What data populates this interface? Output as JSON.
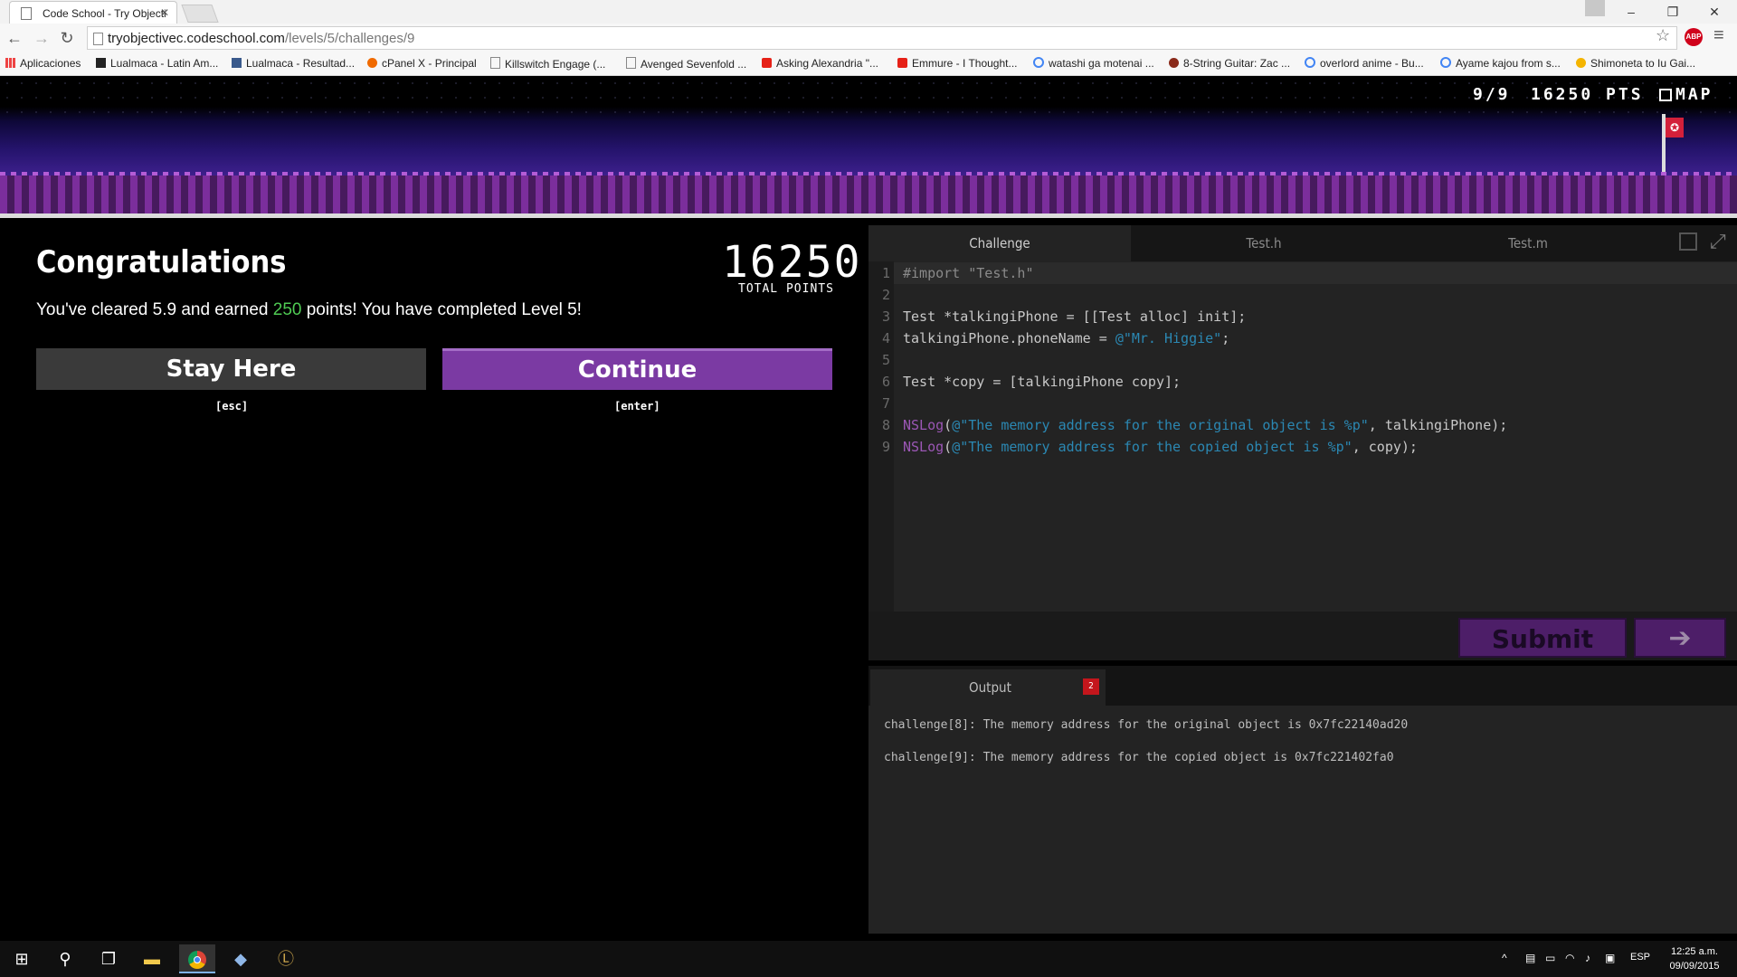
{
  "browser": {
    "tab_title": "Code School - Try Objecti",
    "url_domain": "tryobjectivec.codeschool.com",
    "url_path": "/levels/5/challenges/9",
    "bookmarks": [
      "Aplicaciones",
      "Lualmaca - Latin Am...",
      "Lualmaca - Resultad...",
      "cPanel X - Principal",
      "Killswitch Engage (...",
      "Avenged Sevenfold ...",
      "Asking Alexandria \"...",
      "Emmure - I Thought...",
      "watashi ga motenai ...",
      "8-String Guitar: Zac ...",
      "overlord anime - Bu...",
      "Ayame kajou from s...",
      "Shimoneta to Iu Gai..."
    ]
  },
  "hud": {
    "progress": "9/9",
    "points": "16250 PTS",
    "map": "MAP"
  },
  "result": {
    "title": "Congratulations",
    "total_points": "16250",
    "total_points_label": "TOTAL POINTS",
    "message_prefix": "You've cleared 5.9 and earned ",
    "earned_points": "250",
    "message_suffix": " points! You have completed Level 5!",
    "stay_label": "Stay Here",
    "stay_hint": "[esc]",
    "continue_label": "Continue",
    "continue_hint": "[enter]"
  },
  "editor": {
    "tabs": [
      "Challenge",
      "Test.h",
      "Test.m"
    ],
    "lines": [
      {
        "num": "1",
        "a": "",
        "b": "#import \"Test.h\"",
        "c": "",
        "d": ""
      },
      {
        "num": "2",
        "a": "",
        "b": "",
        "c": "",
        "d": ""
      },
      {
        "num": "3",
        "a": "Test *talkingiPhone = [[Test alloc] init];",
        "b": "",
        "c": "",
        "d": ""
      },
      {
        "num": "4",
        "a": "talkingiPhone.phoneName = ",
        "b": "",
        "c": "@\"Mr. Higgie\"",
        "d": ";"
      },
      {
        "num": "5",
        "a": "",
        "b": "",
        "c": "",
        "d": ""
      },
      {
        "num": "6",
        "a": "Test *copy = [talkingiPhone copy];",
        "b": "",
        "c": "",
        "d": ""
      },
      {
        "num": "7",
        "a": "",
        "b": "",
        "c": "",
        "d": ""
      },
      {
        "num": "8",
        "fn": "NSLog",
        "a": "(",
        "c": "@\"The memory address for the original object is %p\"",
        "d": ", talkingiPhone);"
      },
      {
        "num": "9",
        "fn": "NSLog",
        "a": "(",
        "c": "@\"The memory address for the copied object is %p\"",
        "d": ", copy);"
      }
    ],
    "submit_label": "Submit",
    "next_label": "➔"
  },
  "output": {
    "tab_label": "Output",
    "badge": "2",
    "lines": [
      "challenge[8]: The memory address for the original object is 0x7fc22140ad20",
      "challenge[9]: The memory address for the copied object is 0x7fc221402fa0"
    ]
  },
  "taskbar": {
    "language": "ESP",
    "time": "12:25 a.m.",
    "date": "09/09/2015"
  },
  "colors": {
    "accent_purple": "#7b3aa3",
    "points_green": "#4fcb53",
    "string_blue": "#2b88b3",
    "function_purple": "#9b57b5",
    "badge_red": "#c4161c"
  }
}
